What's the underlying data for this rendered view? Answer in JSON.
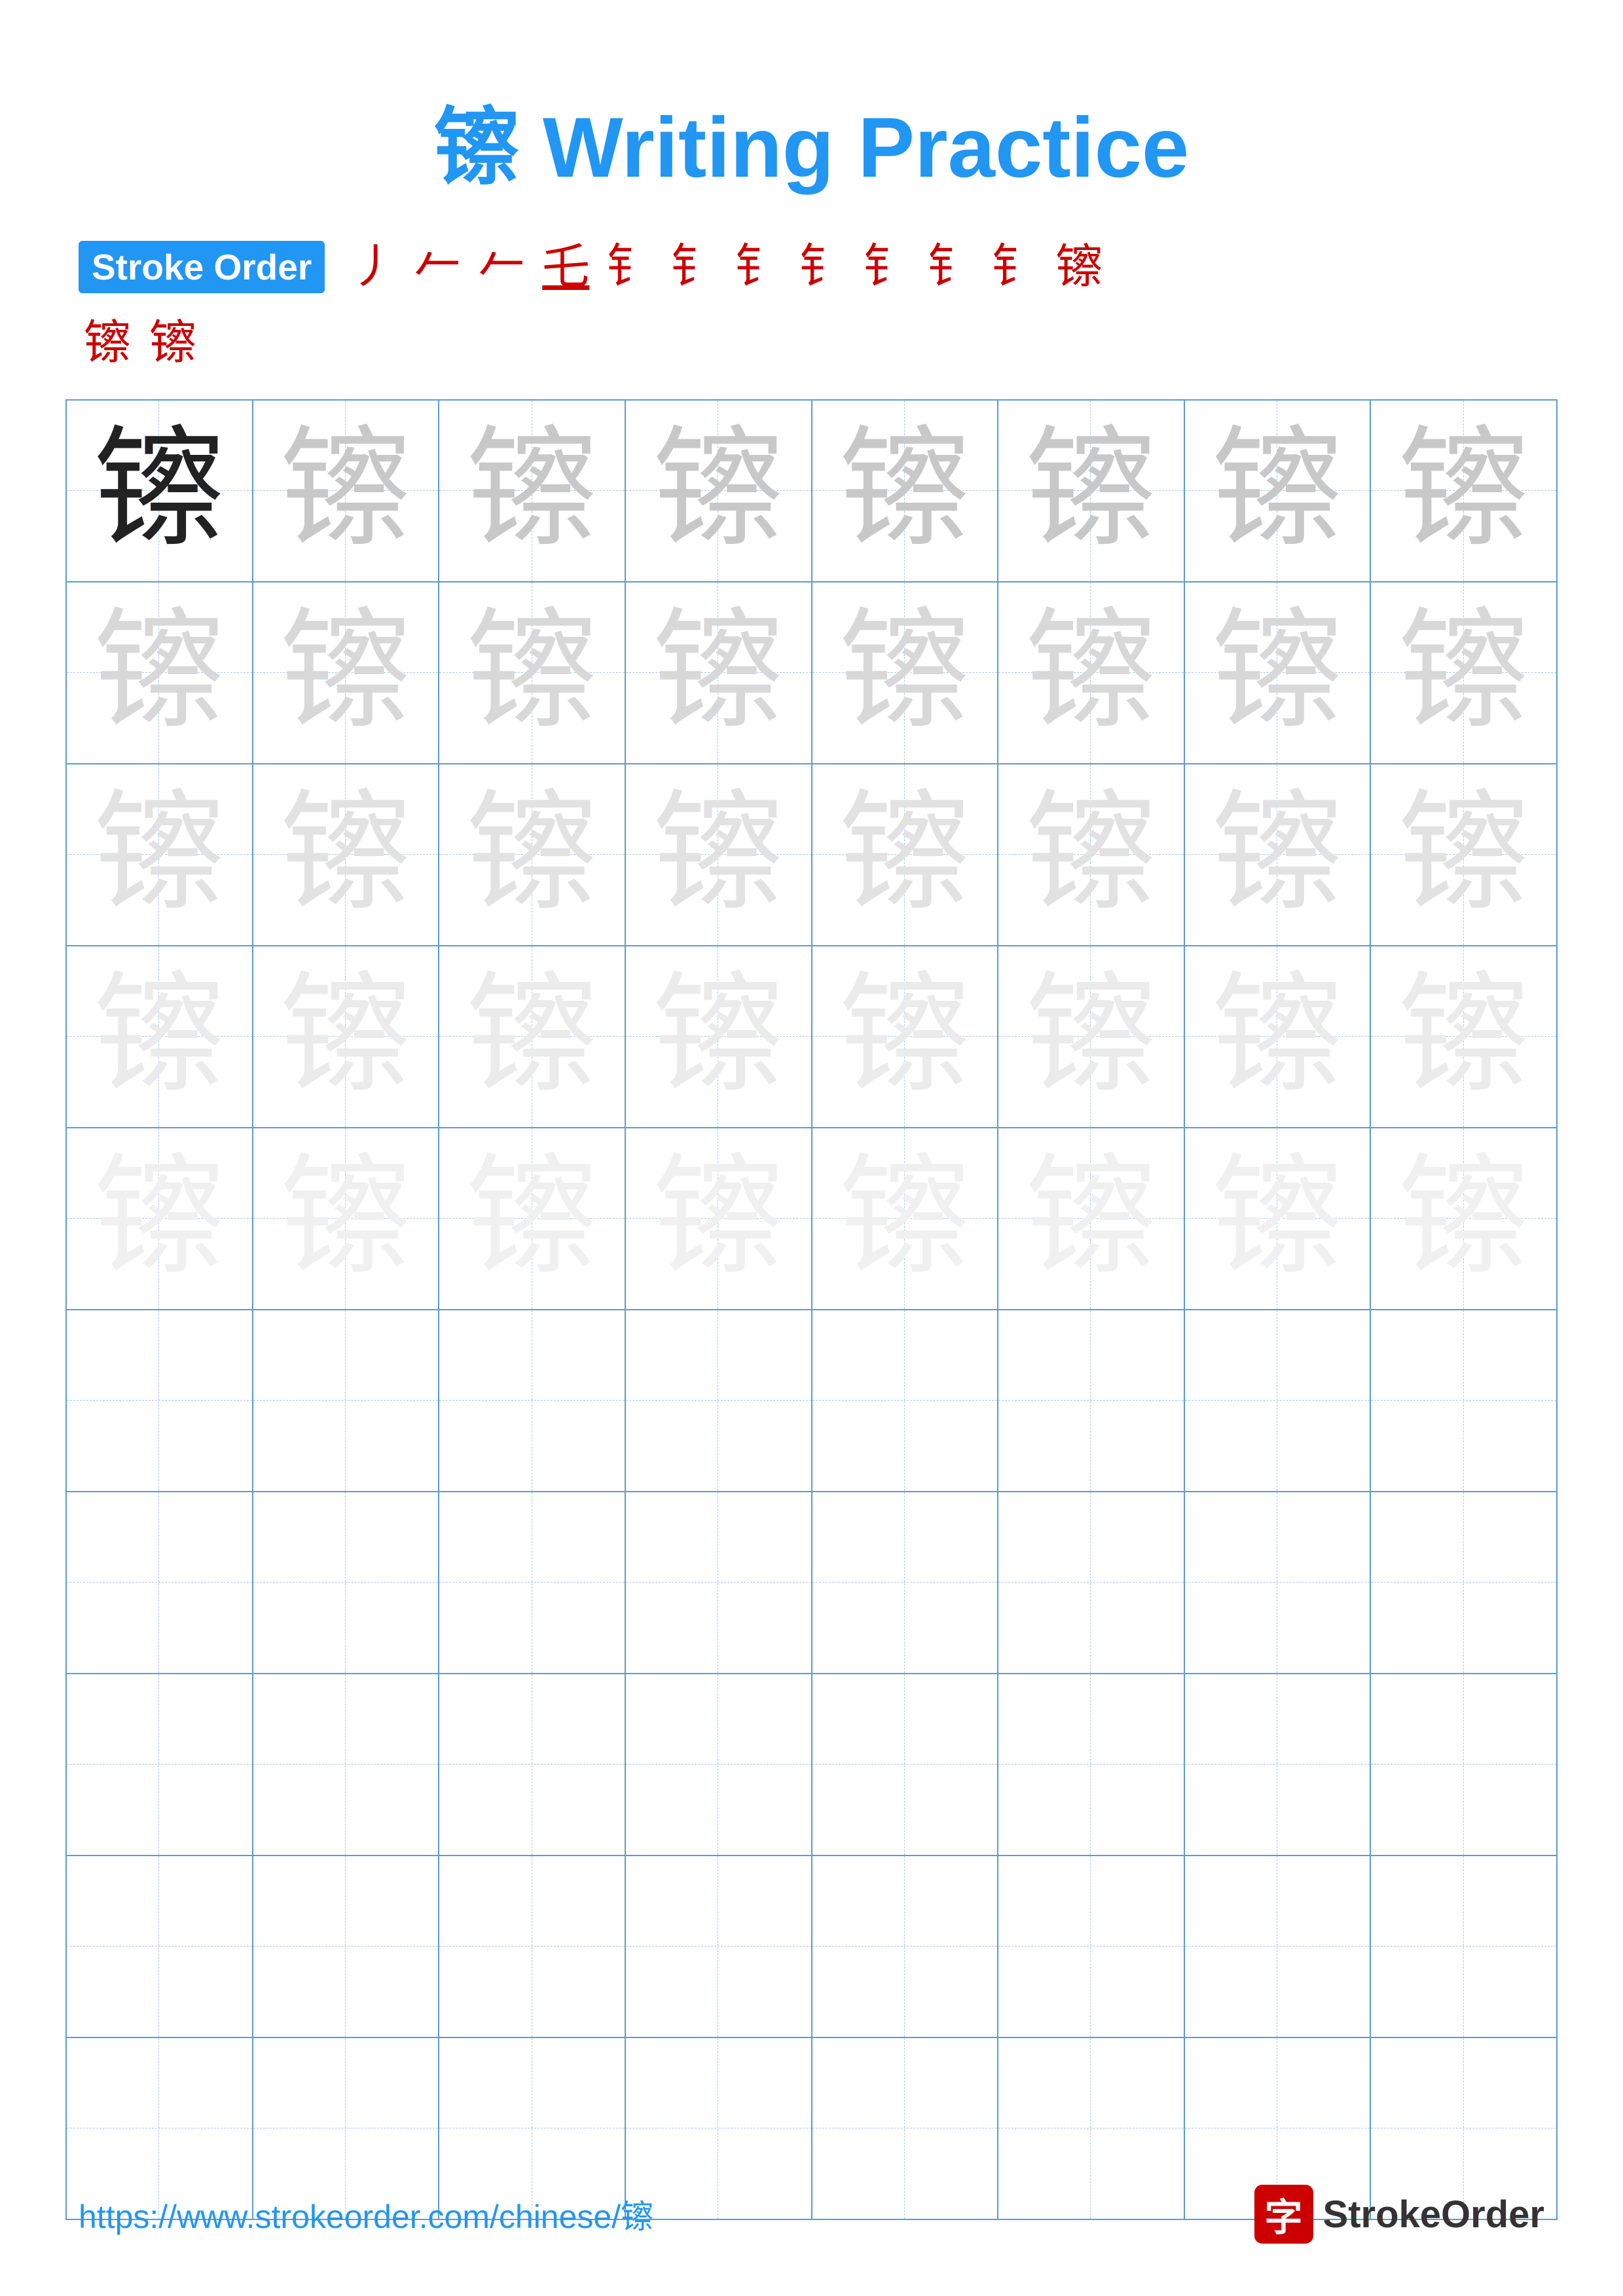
{
  "title": "镲 Writing Practice",
  "character": "镲",
  "stroke_order_label": "Stroke Order",
  "stroke_order_chars_row1": [
    "丿",
    "𠂉",
    "𠂉",
    "乇",
    "钅",
    "钅",
    "钅",
    "钅",
    "钅",
    "钅",
    "钅",
    "镲"
  ],
  "stroke_order_chars_row2": [
    "镲",
    "镲"
  ],
  "footer_url": "https://www.strokeorder.com/chinese/镲",
  "footer_logo_char": "字",
  "footer_logo_text": "StrokeOrder",
  "grid_rows": 10,
  "grid_cols": 8,
  "practice_char": "镲",
  "char_shades": [
    "dark",
    "light1",
    "light1",
    "light1",
    "light1",
    "light2",
    "light2",
    "light3",
    "light3",
    "light4",
    "light4",
    "light5",
    "light5",
    "empty",
    "empty",
    "empty",
    "empty",
    "empty",
    "empty",
    "empty",
    "empty",
    "empty",
    "empty",
    "empty"
  ]
}
